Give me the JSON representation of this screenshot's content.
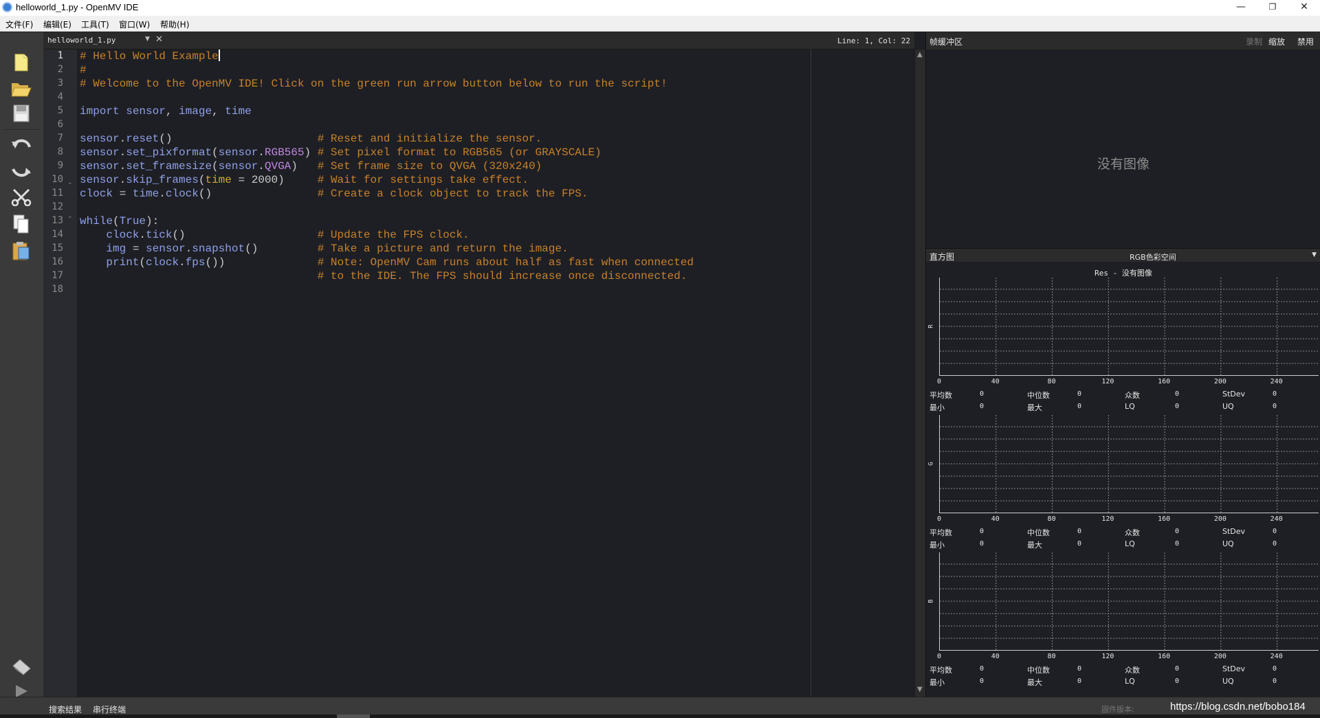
{
  "window": {
    "title": "helloworld_1.py - OpenMV IDE",
    "minimize": "—",
    "restore": "❐",
    "close": "✕"
  },
  "menu": [
    {
      "label": "文件(F)"
    },
    {
      "label": "编辑(E)"
    },
    {
      "label": "工具(T)"
    },
    {
      "label": "窗口(W)"
    },
    {
      "label": "帮助(H)"
    }
  ],
  "toolbar": {
    "icons": [
      "new-file-icon",
      "open-folder-icon",
      "save-icon",
      "undo-icon",
      "redo-icon",
      "cut-icon",
      "copy-icon",
      "paste-icon",
      "connect-icon",
      "run-icon"
    ]
  },
  "editor": {
    "tab_name": "helloworld_1.py",
    "cursor_pos": "Line: 1, Col: 22",
    "line_numbers": [
      "1",
      "2",
      "3",
      "4",
      "5",
      "6",
      "7",
      "8",
      "9",
      "10",
      "11",
      "12",
      "13",
      "14",
      "15",
      "16",
      "17",
      "18"
    ],
    "lines": [
      "# Hello World Example",
      "#",
      "# Welcome to the OpenMV IDE! Click on the green run arrow button below to run the script!",
      "",
      "import sensor, image, time",
      "",
      "sensor.reset()                      # Reset and initialize the sensor.",
      "sensor.set_pixformat(sensor.RGB565) # Set pixel format to RGB565 (or GRAYSCALE)",
      "sensor.set_framesize(sensor.QVGA)   # Set frame size to QVGA (320x240)",
      "sensor.skip_frames(time = 2000)     # Wait for settings take effect.",
      "clock = time.clock()                # Create a clock object to track the FPS.",
      "",
      "while(True):",
      "    clock.tick()                    # Update the FPS clock.",
      "    img = sensor.snapshot()         # Take a picture and return the image.",
      "    print(clock.fps())              # Note: OpenMV Cam runs about half as fast when connected",
      "                                    # to the IDE. The FPS should increase once disconnected.",
      ""
    ]
  },
  "framebuffer": {
    "title": "帧缓冲区",
    "record": "录制",
    "zoom": "缩放",
    "disable": "禁用",
    "no_image": "没有图像"
  },
  "histogram": {
    "title": "直方图",
    "mode": "RGB色彩空间",
    "subtitle": "Res - 没有图像",
    "x_ticks": [
      "0",
      "40",
      "80",
      "120",
      "160",
      "200",
      "240"
    ],
    "channels": [
      {
        "name": "R",
        "stats": [
          [
            "平均数",
            "0"
          ],
          [
            "中位数",
            "0"
          ],
          [
            "众数",
            "0"
          ],
          [
            "StDev",
            "0"
          ],
          [
            "最小",
            "0"
          ],
          [
            "最大",
            "0"
          ],
          [
            "LQ",
            "0"
          ],
          [
            "UQ",
            "0"
          ]
        ]
      },
      {
        "name": "G",
        "stats": [
          [
            "平均数",
            "0"
          ],
          [
            "中位数",
            "0"
          ],
          [
            "众数",
            "0"
          ],
          [
            "StDev",
            "0"
          ],
          [
            "最小",
            "0"
          ],
          [
            "最大",
            "0"
          ],
          [
            "LQ",
            "0"
          ],
          [
            "UQ",
            "0"
          ]
        ]
      },
      {
        "name": "B",
        "stats": [
          [
            "平均数",
            "0"
          ],
          [
            "中位数",
            "0"
          ],
          [
            "众数",
            "0"
          ],
          [
            "StDev",
            "0"
          ],
          [
            "最小",
            "0"
          ],
          [
            "最大",
            "0"
          ],
          [
            "LQ",
            "0"
          ],
          [
            "UQ",
            "0"
          ]
        ]
      }
    ]
  },
  "bottom": {
    "tab_search": "搜索结果",
    "tab_terminal": "串行终端",
    "firmware_label": "固件版本:",
    "watermark": "https://blog.csdn.net/bobo184"
  },
  "colors": {
    "comment": "#c8812a",
    "identifier": "#8fa0e8",
    "purple": "#c088e0",
    "background": "#1e1f24"
  }
}
